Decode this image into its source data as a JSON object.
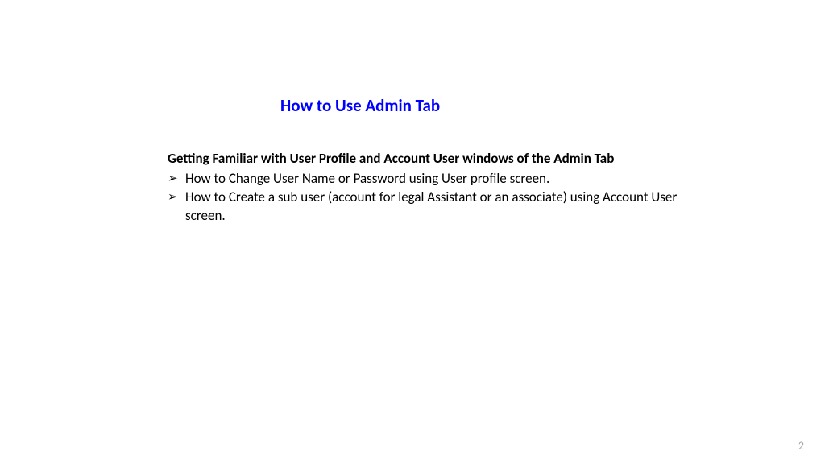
{
  "title": "How to Use Admin Tab",
  "subtitle": "Getting Familiar with User Profile and Account User windows of the Admin Tab",
  "bullets": [
    "How to Change User Name or Password using User profile screen.",
    "How to Create a sub user (account for legal Assistant or an associate) using Account User screen."
  ],
  "page_number": "2",
  "bullet_glyph": "➢"
}
